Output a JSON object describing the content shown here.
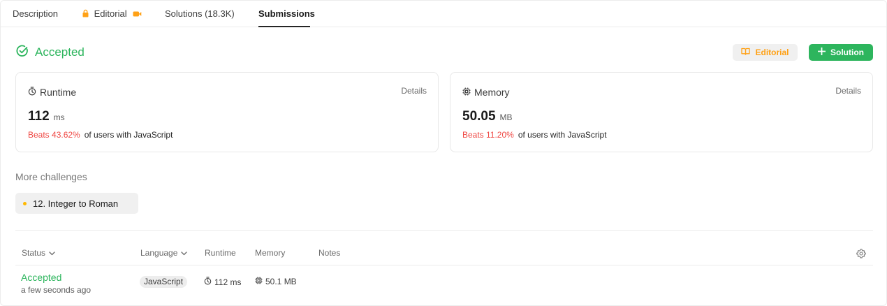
{
  "tabs": [
    {
      "label": "Description",
      "active": false
    },
    {
      "label": "Editorial",
      "active": false,
      "locked": true,
      "has_video": true
    },
    {
      "label": "Solutions (18.3K)",
      "active": false
    },
    {
      "label": "Submissions",
      "active": true
    }
  ],
  "result": {
    "title": "Accepted",
    "status_color": "#2db55d"
  },
  "actions": {
    "editorial_label": "Editorial",
    "solution_label": "Solution"
  },
  "runtime_card": {
    "title": "Runtime",
    "details_label": "Details",
    "value": "112",
    "unit": "ms",
    "beats": "Beats 43.62%",
    "suffix": "of users with JavaScript"
  },
  "memory_card": {
    "title": "Memory",
    "details_label": "Details",
    "value": "50.05",
    "unit": "MB",
    "beats": "Beats 11.20%",
    "suffix": "of users with JavaScript"
  },
  "more_challenges": {
    "label": "More challenges",
    "items": [
      {
        "title": "12. Integer to Roman",
        "difficulty_color": "#ffb800"
      }
    ]
  },
  "table": {
    "headers": {
      "status": "Status",
      "language": "Language",
      "runtime": "Runtime",
      "memory": "Memory",
      "notes": "Notes"
    },
    "rows": [
      {
        "status": "Accepted",
        "time": "a few seconds ago",
        "language": "JavaScript",
        "runtime": "112 ms",
        "memory": "50.1 MB"
      }
    ]
  },
  "colors": {
    "accent_green": "#2db55d",
    "accent_orange": "#ffa116",
    "beats_red": "#ef4743"
  }
}
